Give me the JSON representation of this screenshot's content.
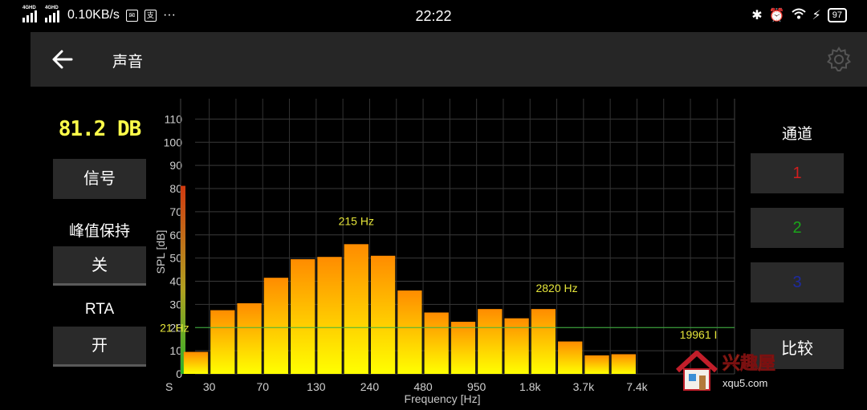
{
  "status_bar": {
    "network": "4GHD",
    "speed": "0.10KB/s",
    "time": "22:22",
    "more": "···",
    "battery": "97"
  },
  "app_bar": {
    "title": "声音"
  },
  "left_panel": {
    "level_readout": "81.2 DB",
    "signal_button": "信号",
    "peak_hold_label": "峰值保持",
    "peak_hold_button": "关",
    "rta_label": "RTA",
    "rta_button": "开"
  },
  "right_panel": {
    "channel_label": "通道",
    "channels": [
      {
        "label": "1",
        "color": "#d21e1e"
      },
      {
        "label": "2",
        "color": "#1aa51a"
      },
      {
        "label": "3",
        "color": "#1e2aa0"
      }
    ],
    "compare_button": "比较"
  },
  "chart_data": {
    "type": "bar",
    "xlabel": "Frequency [Hz]",
    "ylabel": "SPL [dB]",
    "ylim": [
      0,
      115
    ],
    "yticks": [
      0,
      10,
      20,
      30,
      40,
      50,
      60,
      70,
      80,
      90,
      100,
      110
    ],
    "x_tick_labels": [
      "S",
      "30",
      "70",
      "130",
      "240",
      "480",
      "950",
      "1.8k",
      "3.7k",
      "7.4k"
    ],
    "x_tick_bands": [
      -1,
      0.5,
      2.5,
      4.5,
      6.5,
      8.5,
      10.5,
      12.5,
      14.5,
      16.5
    ],
    "values": [
      9.5,
      27.5,
      30.5,
      41.5,
      49.5,
      50.5,
      56,
      51,
      36,
      26.5,
      22.5,
      28,
      24,
      28,
      14,
      8,
      8.5
    ],
    "level_meter": 81.2,
    "reference_level": 20,
    "grid": true,
    "annotations": [
      {
        "text": "215 Hz",
        "band": 6,
        "y": 66
      },
      {
        "text": "21 Hz",
        "band": -0.8,
        "y": 20
      },
      {
        "text": "2820 Hz",
        "band": 13.5,
        "y": 37
      },
      {
        "text": "19961 I",
        "band": 18.8,
        "y": 17
      }
    ],
    "colors": {
      "bar_top": "#ff8c00",
      "bar_bottom": "#ffff00",
      "reference_line": "#3cb43c",
      "annotation": "#e5e53a"
    }
  },
  "watermark": {
    "text": "兴趣屋",
    "url": "xqu5.com"
  }
}
